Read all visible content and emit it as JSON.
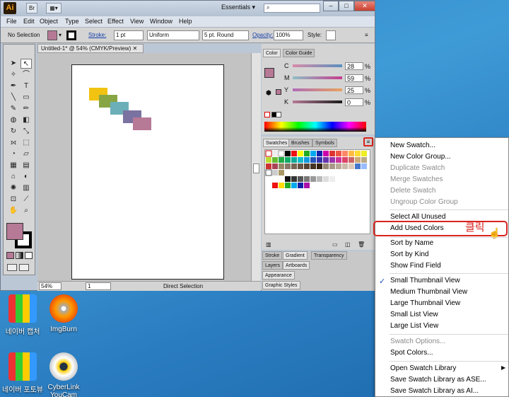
{
  "app": {
    "logo": "Ai",
    "bridge_btn": "Br",
    "workspace": "Essentials",
    "menu": [
      "File",
      "Edit",
      "Object",
      "Type",
      "Select",
      "Effect",
      "View",
      "Window",
      "Help"
    ]
  },
  "control_bar": {
    "selection": "No Selection",
    "stroke_label": "Stroke:",
    "stroke_weight": "1 pt",
    "profile": "Uniform",
    "brush": "5 pt. Round",
    "opacity_label": "Opacity:",
    "opacity_value": "100%",
    "style_label": "Style:"
  },
  "document": {
    "tab_title": "Untitled-1* @ 54% (CMYK/Preview)",
    "zoom": "54%",
    "page": "1",
    "status": "Direct Selection",
    "swatch_colors": [
      "#f2c311",
      "#88a543",
      "#6cafb9",
      "#7a72a0",
      "#b67996"
    ]
  },
  "color_panel": {
    "tabs": [
      "Color",
      "Color Guide"
    ],
    "channels": [
      {
        "label": "C",
        "value": "28"
      },
      {
        "label": "M",
        "value": "59"
      },
      {
        "label": "Y",
        "value": "25"
      },
      {
        "label": "K",
        "value": "0"
      }
    ],
    "pct": "%"
  },
  "swatches_panel": {
    "tabs": [
      "Swatches",
      "Brushes",
      "Symbols"
    ]
  },
  "bottom_panels": {
    "stroke_tabs": [
      "Stroke",
      "Gradient",
      "Transparency"
    ],
    "layer_tabs": [
      "Layers",
      "Artboards"
    ],
    "appearance": "Appearance",
    "graphic_styles": "Graphic Styles"
  },
  "flyout_menu": {
    "items": [
      {
        "label": "New Swatch...",
        "enabled": true
      },
      {
        "label": "New Color Group...",
        "enabled": true
      },
      {
        "label": "Duplicate Swatch",
        "enabled": false
      },
      {
        "label": "Merge Swatches",
        "enabled": false
      },
      {
        "label": "Delete Swatch",
        "enabled": false
      },
      {
        "label": "Ungroup Color Group",
        "enabled": false
      },
      {
        "label": "Select All Unused",
        "enabled": true
      },
      {
        "label": "Add Used Colors",
        "enabled": true
      },
      {
        "label": "Sort by Name",
        "enabled": true
      },
      {
        "label": "Sort by Kind",
        "enabled": true
      },
      {
        "label": "Show Find Field",
        "enabled": true
      },
      {
        "label": "Small Thumbnail View",
        "enabled": true,
        "checked": true
      },
      {
        "label": "Medium Thumbnail View",
        "enabled": true
      },
      {
        "label": "Large Thumbnail View",
        "enabled": true
      },
      {
        "label": "Small List View",
        "enabled": true
      },
      {
        "label": "Large List View",
        "enabled": true
      },
      {
        "label": "Swatch Options...",
        "enabled": false
      },
      {
        "label": "Spot Colors...",
        "enabled": true
      },
      {
        "label": "Open Swatch Library",
        "enabled": true,
        "submenu": true
      },
      {
        "label": "Save Swatch Library as ASE...",
        "enabled": true
      },
      {
        "label": "Save Swatch Library as AI...",
        "enabled": true
      }
    ],
    "annotation": "클릭",
    "highlight_color": "#d8231e"
  },
  "desktop": {
    "icons": [
      "네이버 캡처",
      "ImgBurn",
      "네이버 포토뷰",
      "CyberLink YouCam"
    ]
  }
}
